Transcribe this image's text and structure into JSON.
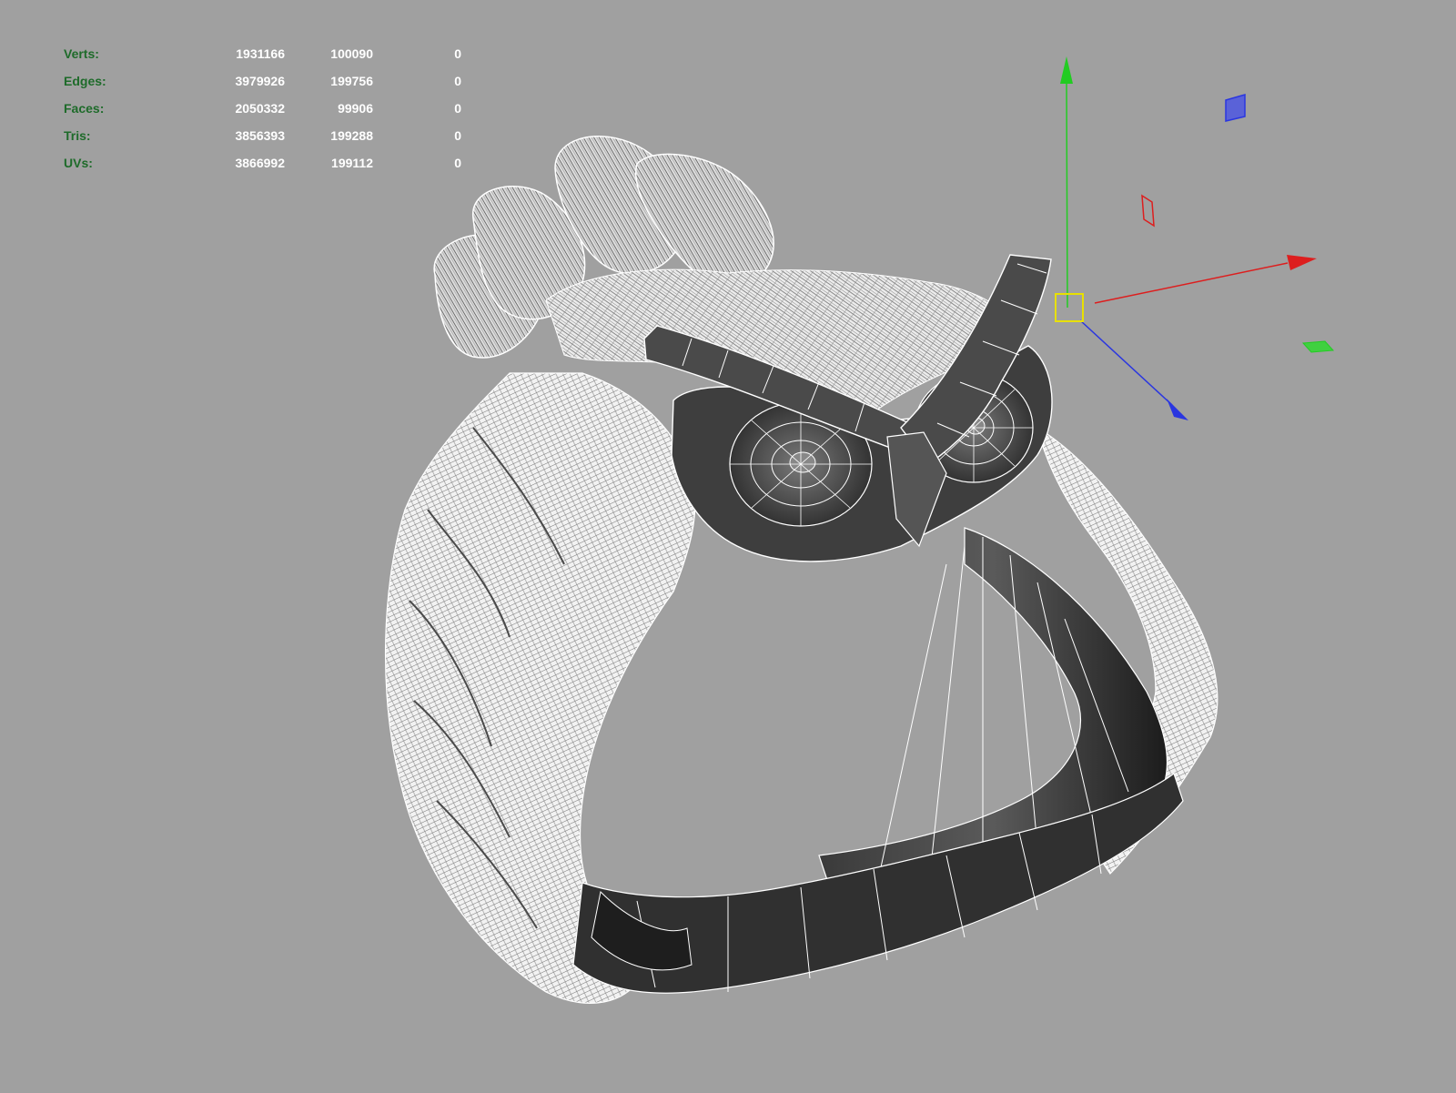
{
  "viewport": {
    "background": "#a0a0a0",
    "object": "owl-ring-wireframe",
    "manipulator": "move-tool-gizmo",
    "axis_colors": {
      "x": "#dd1e1e",
      "y": "#22cc22",
      "z": "#2a36e0",
      "pivot": "#e8e000"
    }
  },
  "heads_up_display": {
    "rows": [
      {
        "label": "Verts:",
        "total": "1931166",
        "selected": "100090",
        "third": "0"
      },
      {
        "label": "Edges:",
        "total": "3979926",
        "selected": "199756",
        "third": "0"
      },
      {
        "label": "Faces:",
        "total": "2050332",
        "selected": "99906",
        "third": "0"
      },
      {
        "label": "Tris:",
        "total": "3856393",
        "selected": "199288",
        "third": "0"
      },
      {
        "label": "UVs:",
        "total": "3866992",
        "selected": "199112",
        "third": "0"
      }
    ],
    "label_color": "#1e6b2a",
    "value_color": "#ffffff"
  }
}
